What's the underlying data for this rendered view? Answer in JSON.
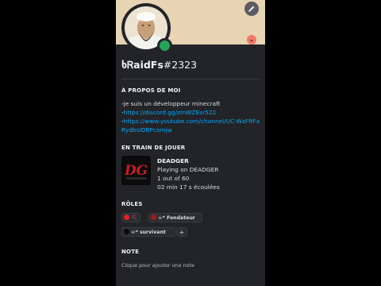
{
  "colors": {
    "panel_bg": "#232428",
    "banner": "#e6d4b2",
    "online": "#23a55a",
    "link": "#00a8fc",
    "role_red": "#e52222",
    "role_dark_red": "#a31d1d",
    "role_black": "#0a0a0a"
  },
  "profile": {
    "username": "ხᏒaidFs",
    "discriminator": "#2323",
    "status": "online",
    "edit_icon": "pencil-icon",
    "badge_icon": "chevron-down-icon"
  },
  "about": {
    "title": "À PROPOS DE MOI",
    "line1": "-je suis un développeur minecraft",
    "link1_prefix": "-",
    "link1": "https://discord.gg/zmWZEsr522",
    "link2_prefix": "-",
    "link2": "https://www.youtube.com/channel/UC-WzFftFxRydbsIOBPcamjw"
  },
  "activity": {
    "title": "EN TRAIN DE JOUER",
    "game_name": "DEADGER",
    "details": "Playing on DEADGER",
    "party": "1 out of 60",
    "elapsed": "02 min 17 s écoulées"
  },
  "roles": {
    "title": "RÔLES",
    "items": [
      {
        "emoji": "⛏",
        "label": ""
      },
      {
        "emoji": "☠",
        "label": "* Fondateur"
      },
      {
        "emoji": "☠",
        "label": "* survivant"
      }
    ],
    "add_label": "+"
  },
  "note": {
    "title": "NOTE",
    "placeholder": "Clique pour ajouter une note"
  }
}
